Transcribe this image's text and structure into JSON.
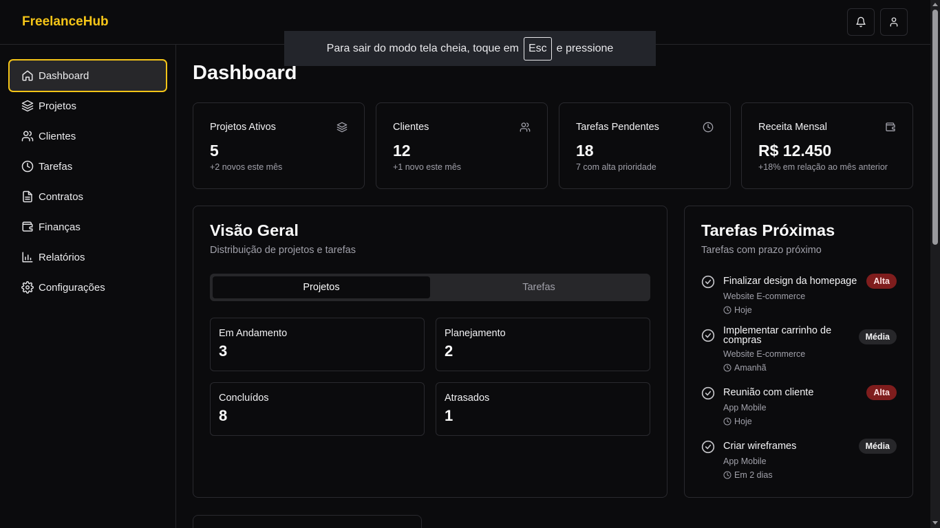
{
  "app": {
    "brand": "FreelanceHub"
  },
  "header": {
    "notifications_icon": "bell-icon",
    "user_icon": "user-icon"
  },
  "fullscreen_toast": {
    "before": "Para sair do modo tela cheia, toque em",
    "key": "Esc",
    "after": "e pressione"
  },
  "sidebar": {
    "items": [
      {
        "label": "Dashboard",
        "icon": "home-icon",
        "active": true
      },
      {
        "label": "Projetos",
        "icon": "layers-icon"
      },
      {
        "label": "Clientes",
        "icon": "users-icon"
      },
      {
        "label": "Tarefas",
        "icon": "clock-icon"
      },
      {
        "label": "Contratos",
        "icon": "file-icon"
      },
      {
        "label": "Finanças",
        "icon": "wallet-icon"
      },
      {
        "label": "Relatórios",
        "icon": "bar-chart-icon"
      },
      {
        "label": "Configurações",
        "icon": "gear-icon"
      }
    ]
  },
  "main": {
    "title": "Dashboard",
    "stats": [
      {
        "title": "Projetos Ativos",
        "value": "5",
        "sub": "+2 novos este mês",
        "icon": "layers-icon"
      },
      {
        "title": "Clientes",
        "value": "12",
        "sub": "+1 novo este mês",
        "icon": "users-icon"
      },
      {
        "title": "Tarefas Pendentes",
        "value": "18",
        "sub": "7 com alta prioridade",
        "icon": "clock-icon"
      },
      {
        "title": "Receita Mensal",
        "value": "R$ 12.450",
        "sub": "+18% em relação ao mês anterior",
        "icon": "wallet-icon"
      }
    ],
    "overview": {
      "title": "Visão Geral",
      "subtitle": "Distribuição de projetos e tarefas",
      "tabs": [
        {
          "label": "Projetos",
          "active": true
        },
        {
          "label": "Tarefas",
          "active": false
        }
      ],
      "boxes": [
        {
          "label": "Em Andamento",
          "value": "3"
        },
        {
          "label": "Planejamento",
          "value": "2"
        },
        {
          "label": "Concluídos",
          "value": "8"
        },
        {
          "label": "Atrasados",
          "value": "1"
        }
      ]
    },
    "upcoming": {
      "title": "Tarefas Próximas",
      "subtitle": "Tarefas com prazo próximo",
      "tasks": [
        {
          "title": "Finalizar design da homepage",
          "project": "Website E-commerce",
          "due": "Hoje",
          "priority": "Alta"
        },
        {
          "title": "Implementar carrinho de compras",
          "project": "Website E-commerce",
          "due": "Amanhã",
          "priority": "Média"
        },
        {
          "title": "Reunião com cliente",
          "project": "App Mobile",
          "due": "Hoje",
          "priority": "Alta"
        },
        {
          "title": "Criar wireframes",
          "project": "App Mobile",
          "due": "Em 2 dias",
          "priority": "Média"
        }
      ]
    }
  },
  "colors": {
    "accent": "#f5c518",
    "background": "#0b0b0d",
    "badge_high": "#7f1d1d",
    "badge_medium": "#27272a"
  }
}
